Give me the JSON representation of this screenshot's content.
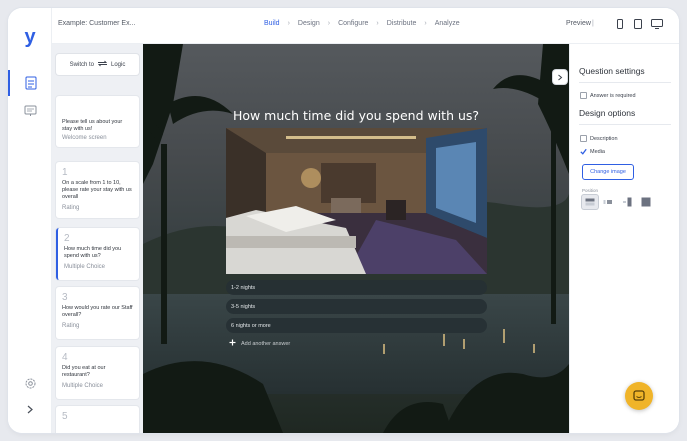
{
  "app": {
    "logo_text": "y",
    "survey_name": "Example: Customer Ex..."
  },
  "nav": {
    "steps": [
      {
        "label": "Build",
        "active": true
      },
      {
        "label": "Design",
        "active": false
      },
      {
        "label": "Configure",
        "active": false
      },
      {
        "label": "Distribute",
        "active": false
      },
      {
        "label": "Analyze",
        "active": false
      }
    ],
    "separator": "›",
    "preview_label": "Preview",
    "preview_separator": "|"
  },
  "sidebar": {
    "logic_button": {
      "prefix": "Switch to",
      "suffix": "Logic"
    },
    "questions": [
      {
        "number": "",
        "text": "Please tell us about your stay with us!",
        "type": "Welcome screen"
      },
      {
        "number": "1",
        "text": "On a scale from 1 to 10, please rate your stay with us overall",
        "type": "Rating"
      },
      {
        "number": "2",
        "text": "How much time did you spend with us?",
        "type": "Multiple Choice"
      },
      {
        "number": "3",
        "text": "How would you rate our Staff overall?",
        "type": "Rating"
      },
      {
        "number": "4",
        "text": "Did you eat at our restaurant?",
        "type": "Multiple Choice"
      },
      {
        "number": "5",
        "text": "",
        "type": ""
      }
    ]
  },
  "question": {
    "title": "How much time did you spend with us?",
    "choices": [
      "1-2 nights",
      "3-5 nights",
      "6 nights or more"
    ],
    "add_answer_label": "Add another answer"
  },
  "settings": {
    "title": "Question settings",
    "answer_required_label": "Answer is required",
    "answer_required": false,
    "design_title": "Design options",
    "description_label": "Description",
    "description_checked": false,
    "media_label": "Media",
    "media_checked": true,
    "change_image_label": "Change image",
    "position_label": "Position"
  },
  "colors": {
    "accent": "#2f5fe3",
    "chat": "#f0b429"
  },
  "icons": [
    "logo",
    "build-list-icon",
    "design-icon",
    "settings-gear-icon",
    "expand-arrow-icon",
    "logic-swap-icon",
    "phone-icon",
    "tablet-icon",
    "desktop-icon",
    "collapse-arrow-icon",
    "plus-icon",
    "check-icon",
    "chat-icon"
  ]
}
